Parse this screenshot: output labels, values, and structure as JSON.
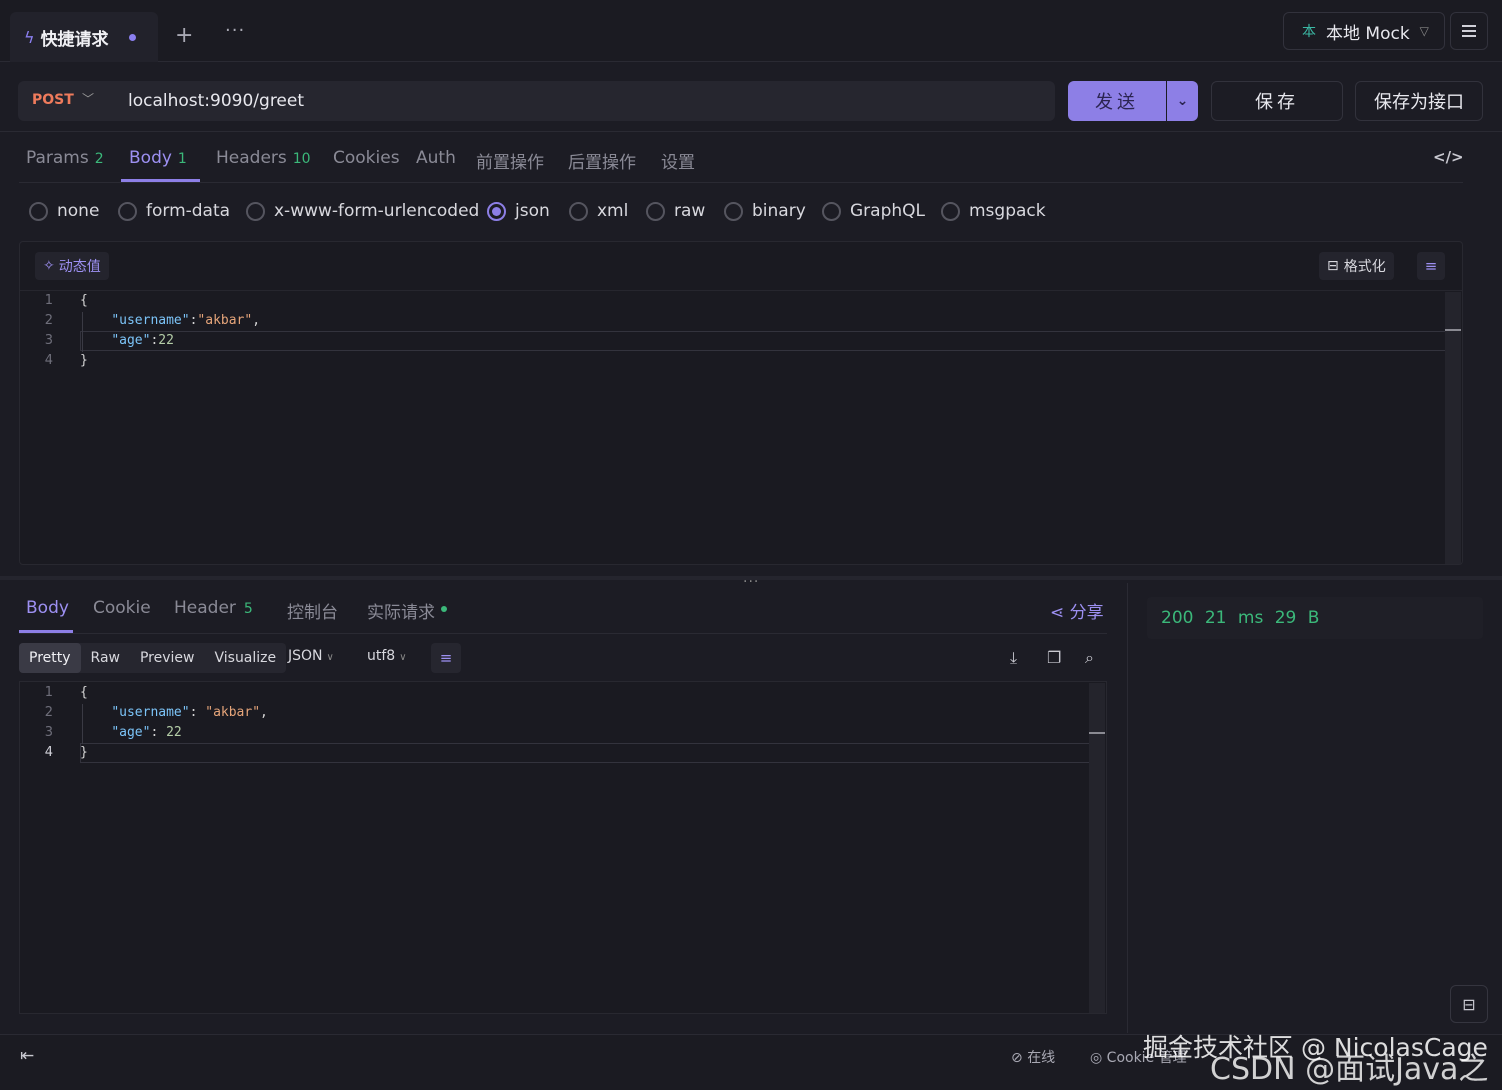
{
  "titlebar": {
    "tab_title": "快捷请求",
    "add_icon": "plus-icon",
    "more_icon": "ellipsis-icon",
    "env_icon_text": "本",
    "env_label": "本地 Mock"
  },
  "request": {
    "method": "POST",
    "url": "localhost:9090/greet",
    "send_label": "发送",
    "save_label": "保存",
    "save_as_api_label": "保存为接口"
  },
  "req_tabs": [
    {
      "label": "Params",
      "count": "2"
    },
    {
      "label": "Body",
      "count": "1"
    },
    {
      "label": "Headers",
      "count": "10"
    },
    {
      "label": "Cookies",
      "count": ""
    },
    {
      "label": "Auth",
      "count": ""
    },
    {
      "label": "前置操作",
      "count": ""
    },
    {
      "label": "后置操作",
      "count": ""
    },
    {
      "label": "设置",
      "count": ""
    }
  ],
  "body_types": [
    "none",
    "form-data",
    "x-www-form-urlencoded",
    "json",
    "xml",
    "raw",
    "binary",
    "GraphQL",
    "msgpack"
  ],
  "body_type_selected": "json",
  "editor": {
    "dynamic_value_label": "动态值",
    "format_label": "格式化",
    "lines": [
      "{",
      "    \"username\":\"akbar\",",
      "    \"age\":22",
      "}"
    ]
  },
  "response": {
    "tabs": [
      {
        "label": "Body",
        "count": ""
      },
      {
        "label": "Cookie",
        "count": ""
      },
      {
        "label": "Header",
        "count": "5"
      },
      {
        "label": "控制台",
        "count": ""
      },
      {
        "label": "实际请求",
        "count": ""
      }
    ],
    "share_label": "分享",
    "view_modes": [
      "Pretty",
      "Raw",
      "Preview",
      "Visualize"
    ],
    "view_mode_selected": "Pretty",
    "format": "JSON",
    "encoding": "utf8",
    "lines": [
      "{",
      "    \"username\": \"akbar\",",
      "    \"age\": 22",
      "}"
    ],
    "status_code": "200",
    "time": "21 ms",
    "size": "29 B"
  },
  "footer": {
    "online_label": "在线",
    "cookie_label": "Cookie 管理",
    "watermark_line1": "掘金技术社区 @ NicolasCage",
    "watermark_line2": "CSDN @面试Java之父"
  },
  "colors": {
    "accent": "#8d7fe6",
    "method_post": "#ef7b5c",
    "success": "#3bb87a",
    "background": "#1c1c24"
  }
}
